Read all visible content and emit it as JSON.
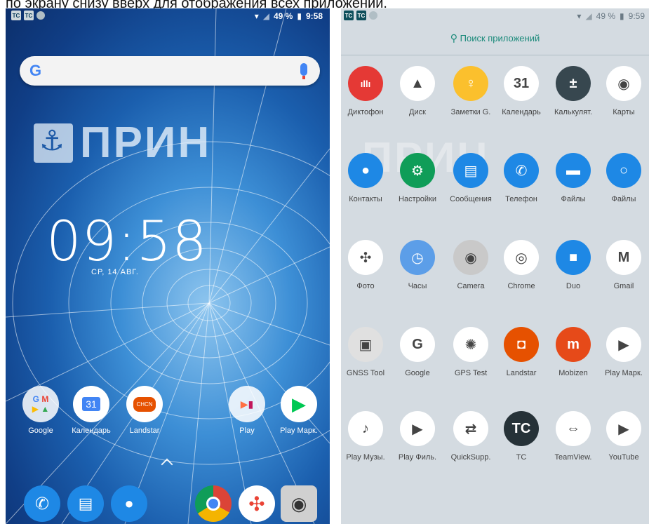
{
  "caption": "по экрану снизу вверх для отображения всех приложений.",
  "left": {
    "status": {
      "battery": "49 %",
      "time": "9:58"
    },
    "logo_text": "ПРИН",
    "clock": "09:58",
    "date": "СР, 14 АВГ.",
    "apps": [
      {
        "label": "Google"
      },
      {
        "label": "Календарь"
      },
      {
        "label": "Landstar"
      },
      {
        "label": "Play"
      },
      {
        "label": "Play Марк."
      }
    ]
  },
  "right": {
    "status": {
      "battery": "49 %",
      "time": "9:59"
    },
    "search_placeholder": "Поиск приложений",
    "watermark": "ПРИН",
    "apps": [
      {
        "label": "Диктофон",
        "color": "#e53935",
        "glyph": "ıllı"
      },
      {
        "label": "Диск",
        "color": "#ffffff",
        "glyph": "▲"
      },
      {
        "label": "Заметки G.",
        "color": "#fbc02d",
        "glyph": "♀"
      },
      {
        "label": "Календарь",
        "color": "#ffffff",
        "glyph": "31"
      },
      {
        "label": "Калькулят.",
        "color": "#37474f",
        "glyph": "±"
      },
      {
        "label": "Карты",
        "color": "#ffffff",
        "glyph": "◉"
      },
      {
        "label": "Контакты",
        "color": "#1e88e5",
        "glyph": "●"
      },
      {
        "label": "Настройки",
        "color": "#0f9d58",
        "glyph": "⚙"
      },
      {
        "label": "Сообщения",
        "color": "#1e88e5",
        "glyph": "▤"
      },
      {
        "label": "Телефон",
        "color": "#1e88e5",
        "glyph": "✆"
      },
      {
        "label": "Файлы",
        "color": "#1e88e5",
        "glyph": "▬"
      },
      {
        "label": "Файлы",
        "color": "#1e88e5",
        "glyph": "○"
      },
      {
        "label": "Фото",
        "color": "#ffffff",
        "glyph": "✣"
      },
      {
        "label": "Часы",
        "color": "#5c9ee8",
        "glyph": "◷"
      },
      {
        "label": "Camera",
        "color": "#c9c9c9",
        "glyph": "◉"
      },
      {
        "label": "Chrome",
        "color": "#ffffff",
        "glyph": "◎"
      },
      {
        "label": "Duo",
        "color": "#1e88e5",
        "glyph": "■"
      },
      {
        "label": "Gmail",
        "color": "#ffffff",
        "glyph": "M"
      },
      {
        "label": "GNSS Tool",
        "color": "#e0e0e0",
        "glyph": "▣"
      },
      {
        "label": "Google",
        "color": "#ffffff",
        "glyph": "G"
      },
      {
        "label": "GPS Test",
        "color": "#ffffff",
        "glyph": "✺"
      },
      {
        "label": "Landstar",
        "color": "#e65100",
        "glyph": "◘"
      },
      {
        "label": "Mobizen",
        "color": "#e64a19",
        "glyph": "m"
      },
      {
        "label": "Play Марк.",
        "color": "#ffffff",
        "glyph": "▶"
      },
      {
        "label": "Play Музы.",
        "color": "#ffffff",
        "glyph": "♪"
      },
      {
        "label": "Play Филь.",
        "color": "#ffffff",
        "glyph": "▶"
      },
      {
        "label": "QuickSupp.",
        "color": "#ffffff",
        "glyph": "⇄"
      },
      {
        "label": "TC",
        "color": "#263238",
        "glyph": "TC"
      },
      {
        "label": "TeamView.",
        "color": "#ffffff",
        "glyph": "⇔"
      },
      {
        "label": "YouTube",
        "color": "#ffffff",
        "glyph": "▶"
      }
    ]
  }
}
